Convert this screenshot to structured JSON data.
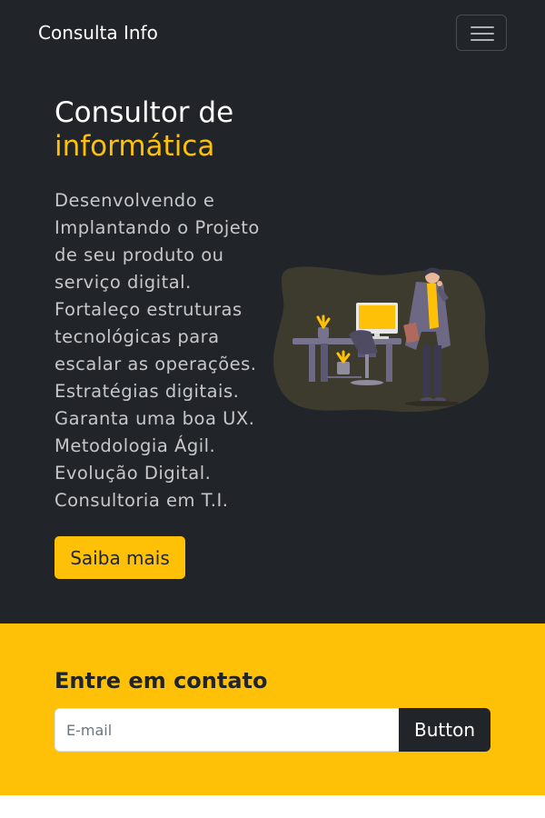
{
  "navbar": {
    "brand": "Consulta Info",
    "toggler_icon": "hamburger-menu-icon"
  },
  "hero": {
    "title_line1": "Consultor de",
    "title_accent": "informática",
    "description": "Desenvolvendo e Implantando o Projeto de seu produto ou serviço digital. Fortaleço estruturas tecnológicas para escalar as operações. Estratégias digitais. Garanta uma boa UX. Metodologia Ágil. Evolução Digital. Consultoria em T.I.",
    "cta_label": "Saiba mais",
    "illustration_icon": "consultant-at-desk-illustration"
  },
  "contact": {
    "title": "Entre em contato",
    "email_placeholder": "E-mail",
    "email_value": "",
    "button_label": "Button"
  },
  "colors": {
    "dark": "#212529",
    "accent": "#ffc107",
    "muted_text": "#c6c7c9",
    "blob": "#3d3a2e",
    "purple": "#6d6984"
  }
}
